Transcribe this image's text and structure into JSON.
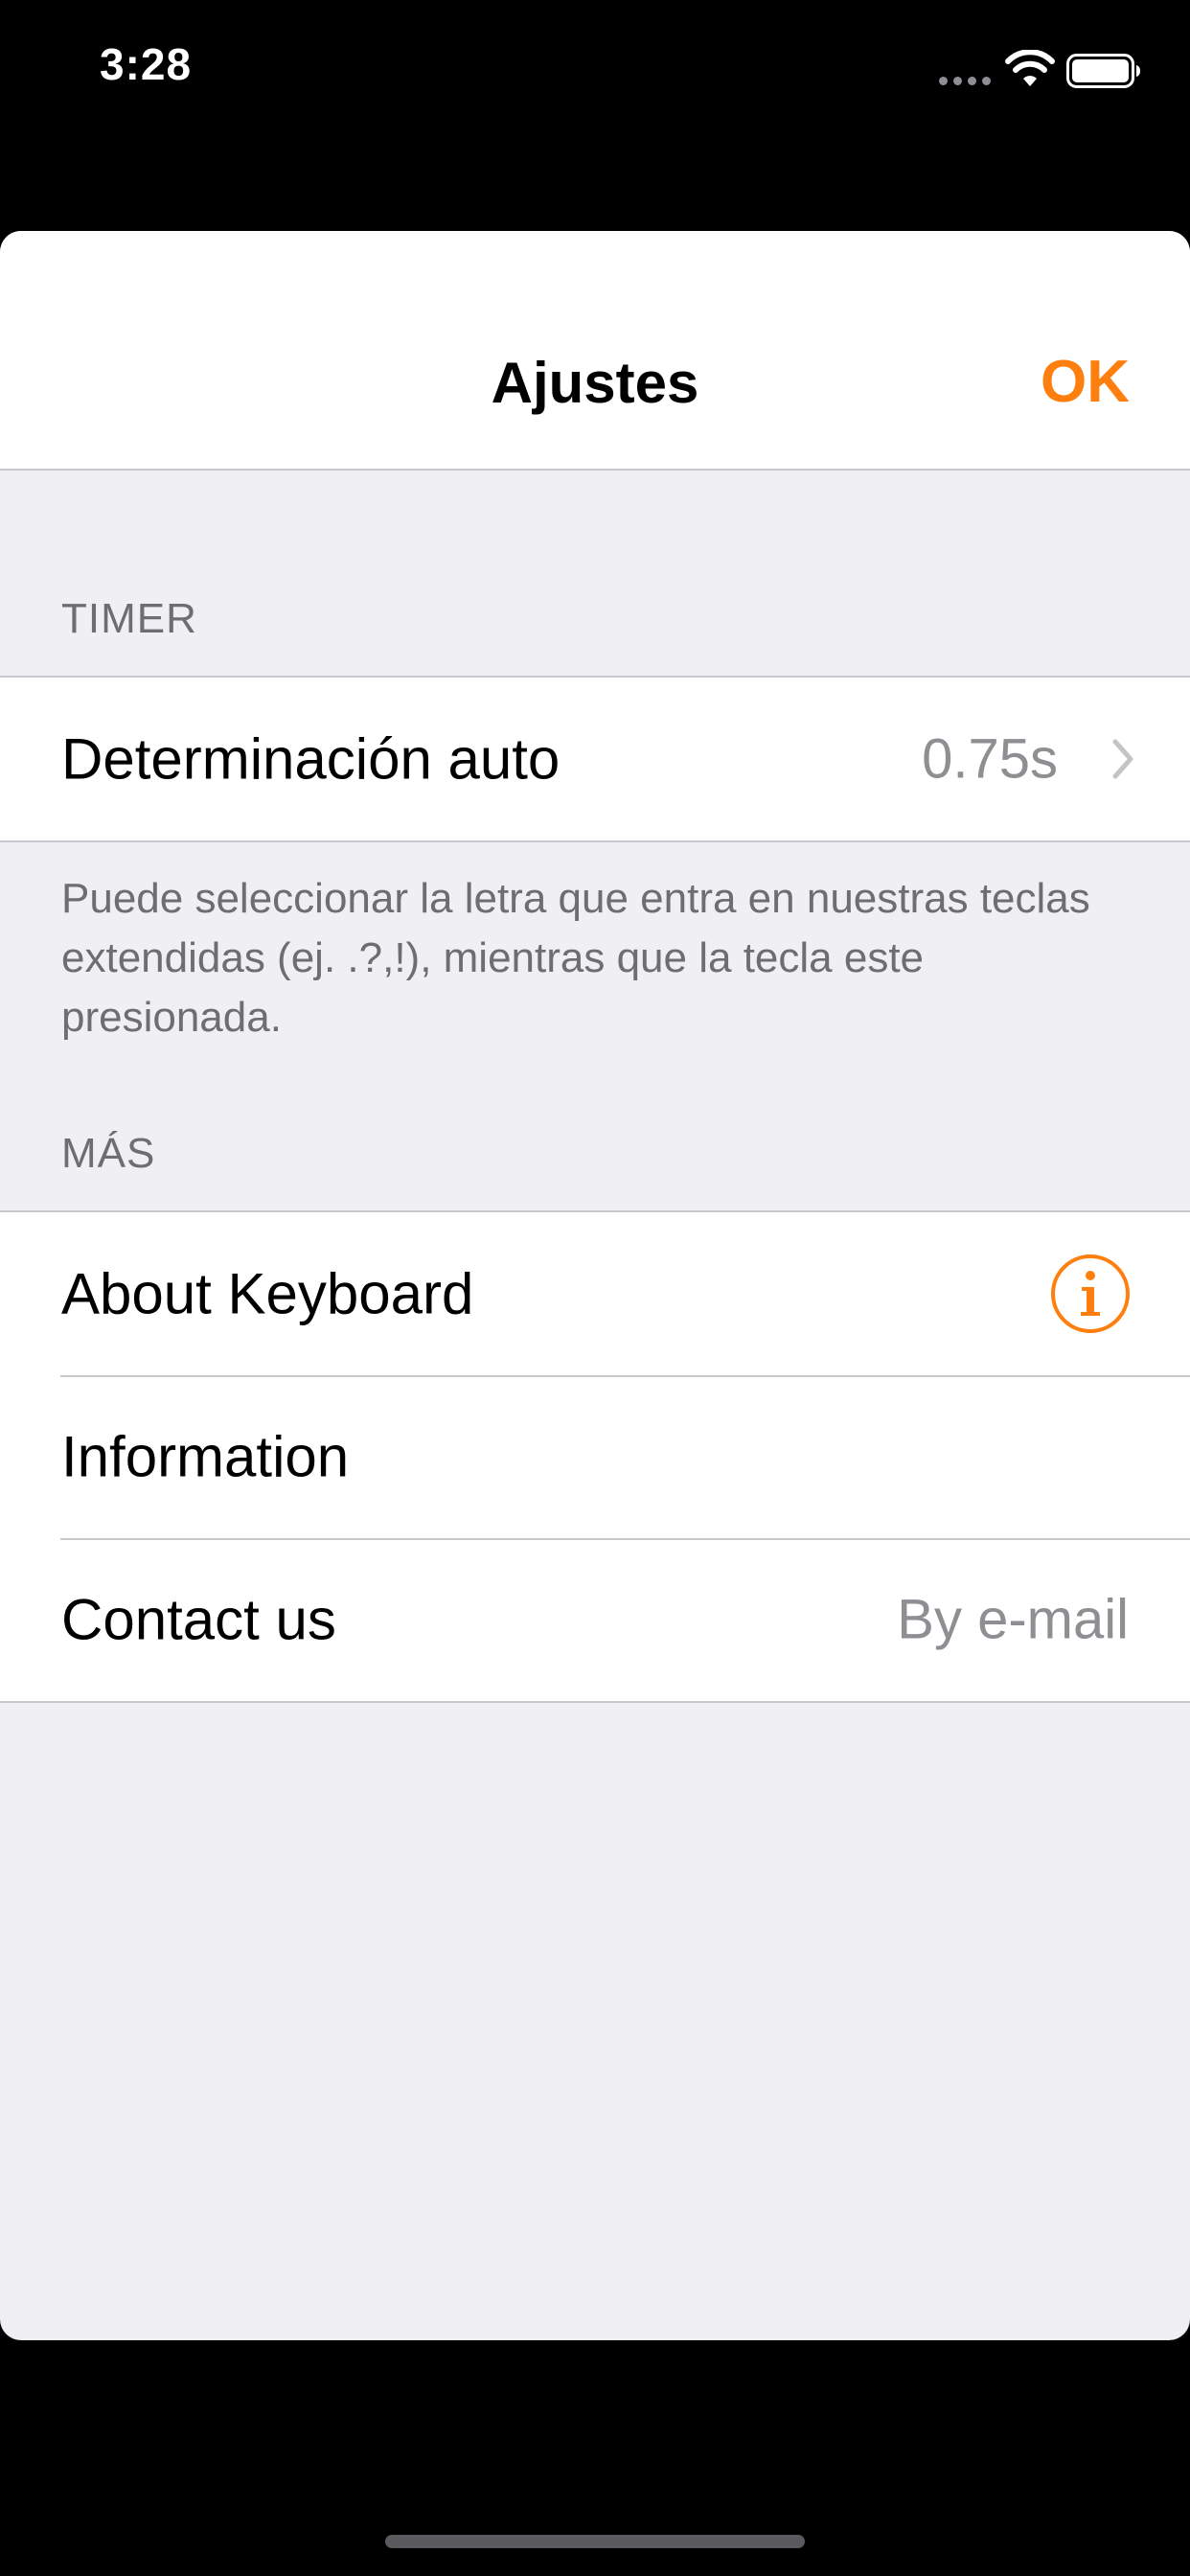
{
  "status_bar": {
    "time": "3:28"
  },
  "nav": {
    "title": "Ajustes",
    "done_label": "OK"
  },
  "timer_section": {
    "header": "TIMER",
    "rows": [
      {
        "label": "Determinación auto",
        "value": "0.75s"
      }
    ],
    "footer": "Puede seleccionar la letra que entra en nuestras teclas extendidas (ej. .?,!), mientras que la tecla este presionada."
  },
  "more_section": {
    "header": "MÁS",
    "rows": [
      {
        "label": "About Keyboard",
        "icon": "info-icon"
      },
      {
        "label": "Information"
      },
      {
        "label": "Contact us",
        "value": "By e-mail"
      }
    ]
  },
  "colors": {
    "accent": "#fe7f0e",
    "background": "#efeff4",
    "secondary_text": "#8e8e93",
    "separator": "#c8c7cc"
  }
}
